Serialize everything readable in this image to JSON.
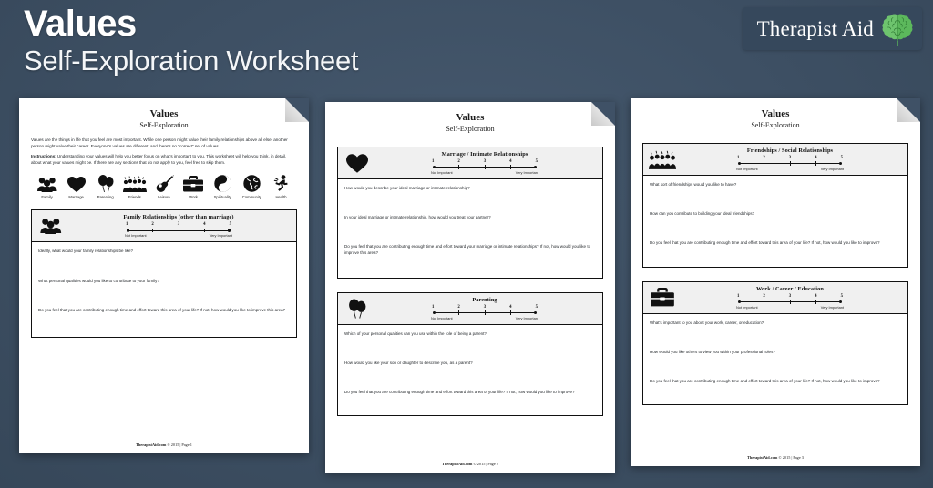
{
  "header": {
    "title": "Values",
    "subtitle": "Self-Exploration Worksheet"
  },
  "logo": {
    "text": "Therapist Aid",
    "icon": "brain-icon",
    "brain_color": "#6ec46e",
    "background": "#36485c"
  },
  "colors": {
    "page_background": "#3e5063",
    "paper": "#ffffff",
    "section_header": "#f0f0f0",
    "ink": "#111111"
  },
  "scale": {
    "numbers": [
      "1",
      "2",
      "3",
      "4",
      "5"
    ],
    "low_label": "Not Important",
    "high_label": "Very Important"
  },
  "worksheet_title": "Values",
  "worksheet_subtitle": "Self-Exploration",
  "intro": {
    "paragraph_1": "Values are the things in life that you feel are most important. While one person might value their family relationships above all else, another person might value their career. Everyone's values are different, and there's no \"correct\" set of values.",
    "instructions_label": "Instructions",
    "instructions_text": ": Understanding your values will help you better focus on what's important to you. This worksheet will help you think, in detail, about what your values might be. If there are any sections that do not apply to you, feel free to skip them."
  },
  "value_icons": [
    {
      "label": "Family",
      "icon": "family-group-icon"
    },
    {
      "label": "Marriage",
      "icon": "heart-icon"
    },
    {
      "label": "Parenting",
      "icon": "balloons-icon"
    },
    {
      "label": "Friends",
      "icon": "crowd-icon"
    },
    {
      "label": "Leisure",
      "icon": "guitar-icon"
    },
    {
      "label": "Work",
      "icon": "briefcase-icon"
    },
    {
      "label": "Spirituality",
      "icon": "yin-yang-icon"
    },
    {
      "label": "Community",
      "icon": "globe-icon"
    },
    {
      "label": "Health",
      "icon": "runner-icon"
    }
  ],
  "pages": [
    {
      "page_label": "Page 1",
      "footer": "TherapistAid.com © 2015  |  Page 1",
      "footer_site": "TherapistAid.com",
      "footer_rest": " © 2015  |  Page 1",
      "sections": [
        {
          "title": "Family Relationships (other than marriage)",
          "icon": "family-group-icon",
          "questions": [
            "Ideally, what would your family relationships be like?",
            "What personal qualities would you like to contribute to your family?",
            "Do you feel that you are contributing enough time and effort toward this area of your life? If not, how would you like to improve this area?"
          ]
        }
      ]
    },
    {
      "page_label": "Page 2",
      "footer": "TherapistAid.com © 2015  |  Page 2",
      "footer_site": "TherapistAid.com",
      "footer_rest": " © 2015  |  Page 2",
      "sections": [
        {
          "title": "Marriage / Intimate Relationships",
          "icon": "heart-icon",
          "questions": [
            "How would you describe your ideal marriage or intimate relationship?",
            "In your ideal marriage or intimate relationship, how would you treat your partner?",
            "Do you feel that you are contributing enough time and effort toward your marriage or intimate relationships? If not, how would you like to improve this area?"
          ]
        },
        {
          "title": "Parenting",
          "icon": "balloons-icon",
          "questions": [
            "Which of your personal qualities can you use within the role of being a parent?",
            "How would you like your son or daughter to describe you, as a parent?",
            "Do you feel that you are contributing enough time and effort toward this area of your life? If not, how would you like to improve?"
          ]
        }
      ]
    },
    {
      "page_label": "Page 3",
      "footer": "TherapistAid.com © 2015  |  Page 3",
      "footer_site": "TherapistAid.com",
      "footer_rest": " © 2015  |  Page 3",
      "sections": [
        {
          "title": "Friendships / Social Relationships",
          "icon": "crowd-icon",
          "questions": [
            "What sort of friendships would you like to have?",
            "How can you contribute to building your ideal friendships?",
            "Do you feel that you are contributing enough time and effort toward this area of your life? If not, how would you like to improve?"
          ]
        },
        {
          "title": "Work / Career / Education",
          "icon": "briefcase-icon",
          "questions": [
            "What's important to you about your work, career, or education?",
            "How would you like others to view you within your professional roles?",
            "Do you feel that you are contributing enough time and effort toward this area of your life? If not, how would you like to improve?"
          ]
        }
      ]
    }
  ]
}
